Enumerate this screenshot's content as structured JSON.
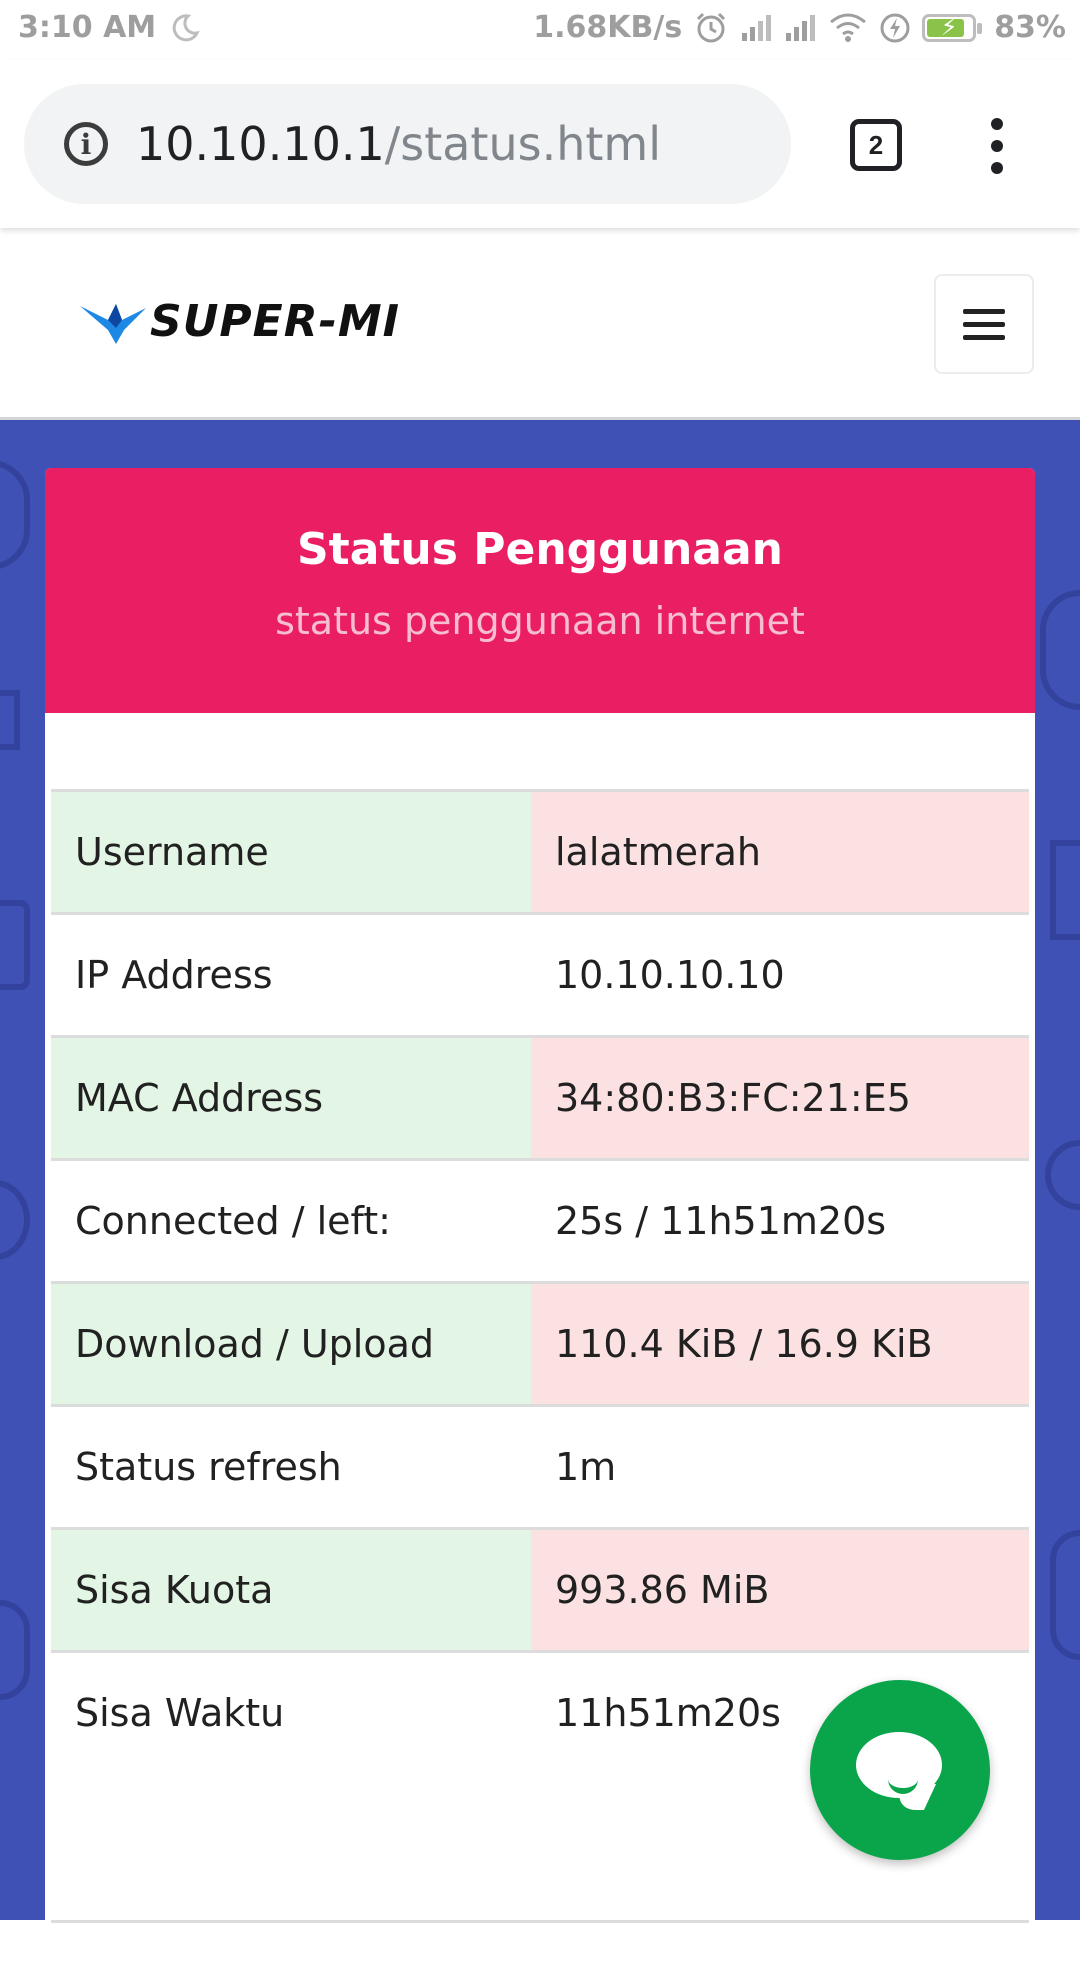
{
  "status_bar": {
    "time": "3:10 AM",
    "network_speed": "1.68KB/s",
    "battery_percent": "83%",
    "battery_level": 0.83,
    "icons": [
      "moon-icon",
      "alarm-icon",
      "signal-icon",
      "signal-icon",
      "wifi-icon",
      "charging-icon",
      "battery-icon"
    ]
  },
  "browser": {
    "url_host": "10.10.10.1",
    "url_path": "/status.html",
    "tab_count": "2"
  },
  "header": {
    "logo_text": "SUPER-MI",
    "logo_color": "#2196f3"
  },
  "card": {
    "title": "Status Penggunaan",
    "subtitle": "status penggunaan internet",
    "header_color": "#e91e63",
    "rows": [
      {
        "label": "Username",
        "value": "lalatmerah"
      },
      {
        "label": "IP Address",
        "value": "10.10.10.10"
      },
      {
        "label": "MAC Address",
        "value": "34:80:B3:FC:21:E5"
      },
      {
        "label": "Connected / left:",
        "value": "25s / 11h51m20s"
      },
      {
        "label": "Download / Upload",
        "value": "110.4 KiB / 16.9 KiB"
      },
      {
        "label": "Status refresh",
        "value": "1m"
      },
      {
        "label": "Sisa Kuota",
        "value": "993.86 MiB"
      },
      {
        "label": "Sisa Waktu",
        "value": "11h51m20s"
      }
    ]
  },
  "colors": {
    "background": "#3f51b5",
    "row_label_stripe": "#e3f5e4",
    "row_value_stripe": "#fbe1e1",
    "chat_button": "#0aa54a"
  }
}
